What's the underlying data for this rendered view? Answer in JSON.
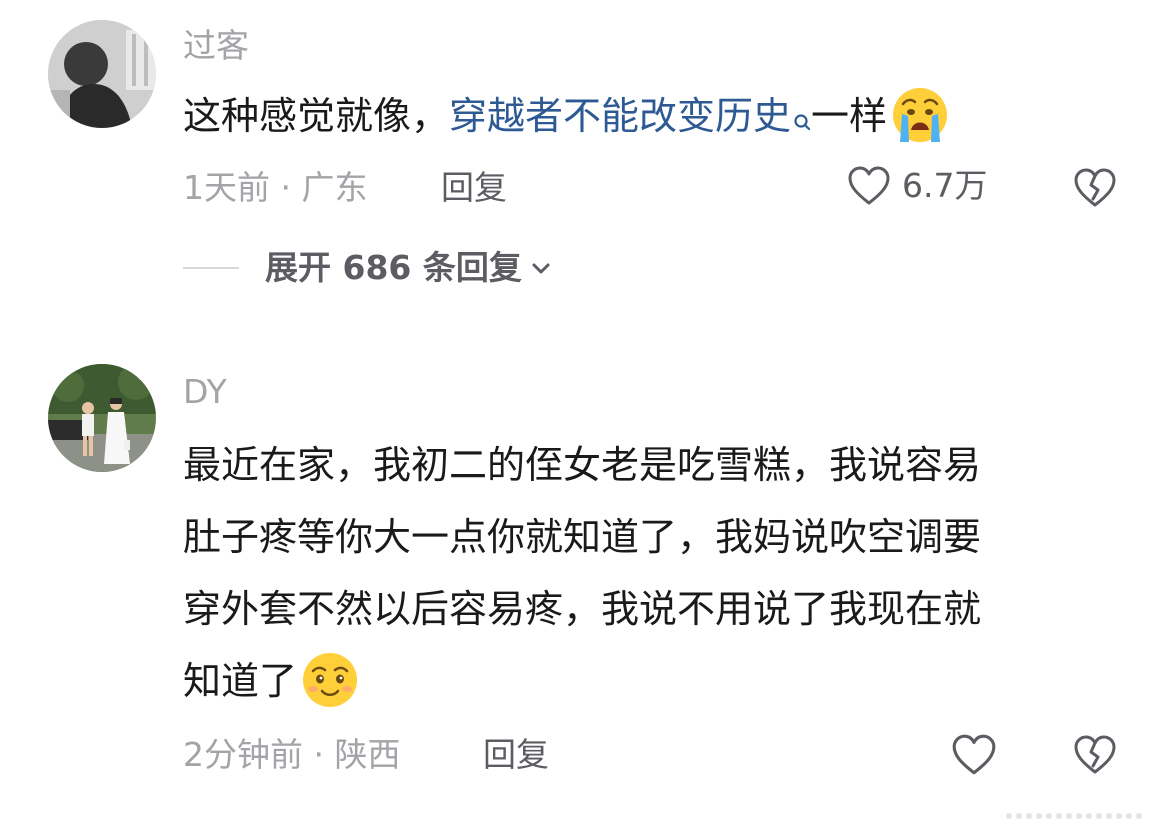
{
  "comments": [
    {
      "username": "过客",
      "text_prefix": "这种感觉就像，",
      "link_text": "穿越者不能改变历史",
      "text_suffix": "一样",
      "emoji": "crying-face",
      "time_location": "1天前 · 广东",
      "reply_label": "回复",
      "like_count": "6.7万",
      "expand_label": "展开 686 条回复"
    },
    {
      "username": "DY",
      "lines": [
        "最近在家，我初二的侄女老是吃雪糕，我说容易",
        "肚子疼等你大一点你就知道了，我妈说吹空调要",
        "穿外套不然以后容易疼，我说不用说了我现在就",
        "知道了"
      ],
      "emoji": "smirking-face",
      "time_location": "2分钟前 · 陕西",
      "reply_label": "回复"
    }
  ],
  "colors": {
    "link": "#2d5a93",
    "meta": "#a3a3a8",
    "action": "#5c5c63",
    "text": "#1a1a1a"
  }
}
